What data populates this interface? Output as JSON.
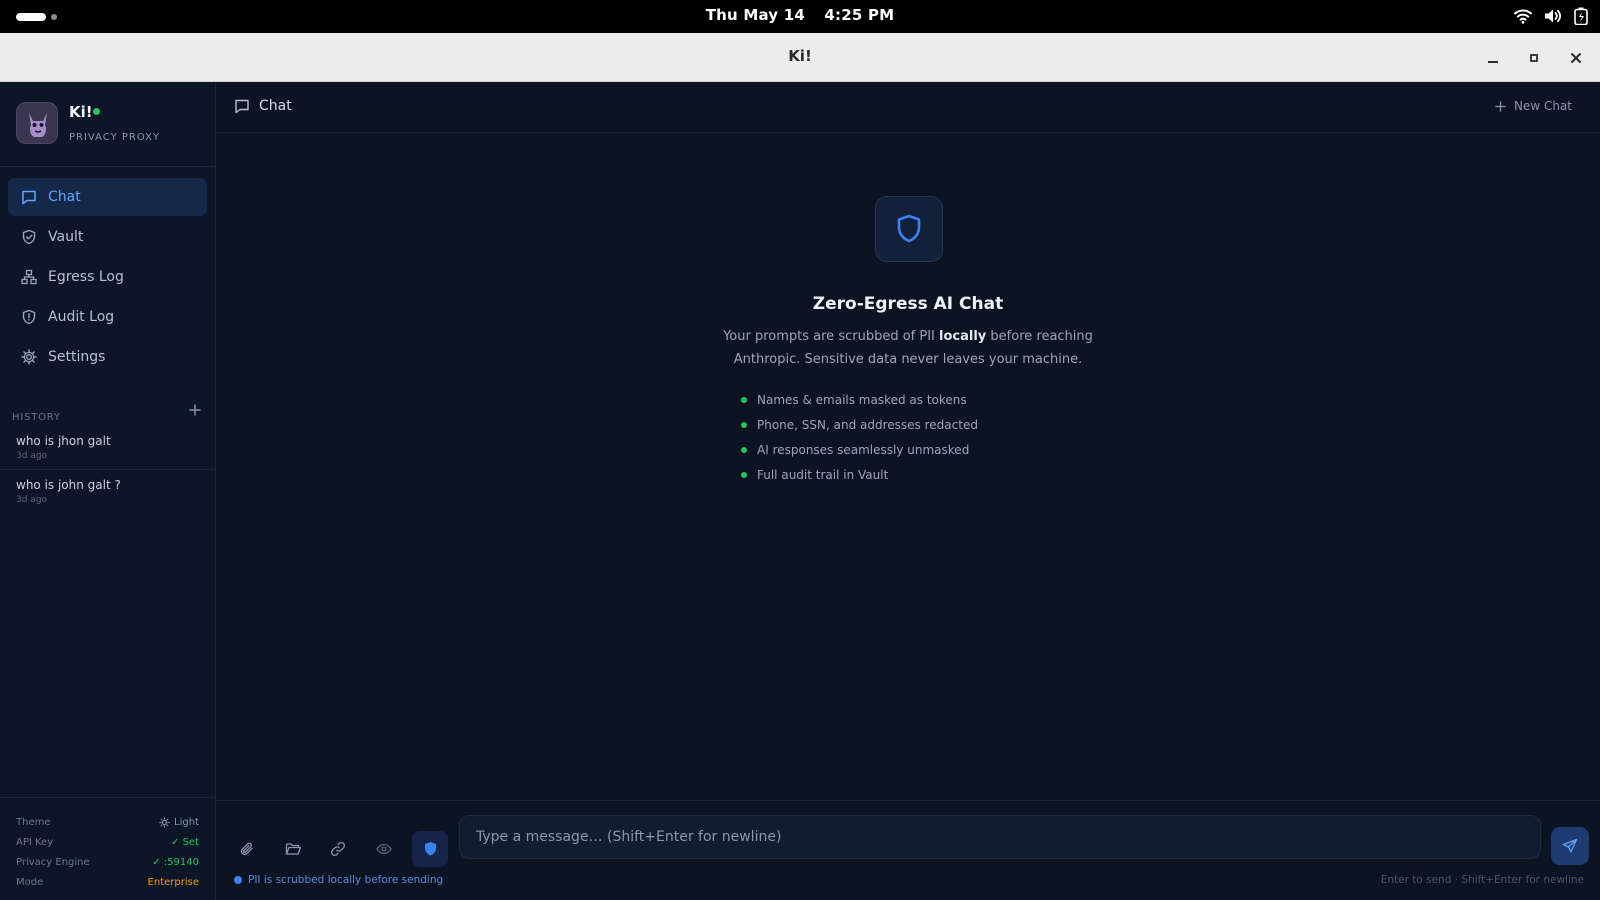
{
  "system": {
    "date": "Thu May 14",
    "time": "4:25 PM"
  },
  "window": {
    "title": "Ki!"
  },
  "brand": {
    "name": "Ki!",
    "subtitle": "PRIVACY PROXY",
    "status_color": "#22c55e"
  },
  "nav": [
    {
      "label": "Chat",
      "icon": "message-square-icon",
      "active": true
    },
    {
      "label": "Vault",
      "icon": "shield-check-icon",
      "active": false
    },
    {
      "label": "Egress Log",
      "icon": "network-icon",
      "active": false
    },
    {
      "label": "Audit Log",
      "icon": "shield-alert-icon",
      "active": false
    },
    {
      "label": "Settings",
      "icon": "gear-icon",
      "active": false
    }
  ],
  "history": {
    "label": "HISTORY",
    "items": [
      {
        "title": "who is jhon galt",
        "date": "3d ago"
      },
      {
        "title": "who is john galt ?",
        "date": "3d ago"
      }
    ]
  },
  "footer": {
    "theme": {
      "label": "Theme",
      "value": "Light"
    },
    "api_key": {
      "label": "API Key",
      "value": "✓ Set"
    },
    "privacy_engine": {
      "label": "Privacy Engine",
      "value": "✓ :59140"
    },
    "mode": {
      "label": "Mode",
      "value": "Enterprise"
    }
  },
  "main": {
    "header_title": "Chat",
    "new_chat_label": "New Chat",
    "hero": {
      "title": "Zero-Egress AI Chat",
      "desc_before": "Your prompts are scrubbed of PII ",
      "desc_bold": "locally",
      "desc_after": " before reaching Anthropic. Sensitive data never leaves your machine."
    },
    "features": [
      "Names & emails masked as tokens",
      "Phone, SSN, and addresses redacted",
      "AI responses seamlessly unmasked",
      "Full audit trail in Vault"
    ]
  },
  "composer": {
    "placeholder": "Type a message… (Shift+Enter for newline)",
    "note": "PII is scrubbed locally before sending",
    "hint": "Enter to send · Shift+Enter for newline"
  },
  "colors": {
    "accent": "#60a5fa",
    "active_bg": "#14284a",
    "success": "#22c55e",
    "warning": "#f59e0b"
  }
}
